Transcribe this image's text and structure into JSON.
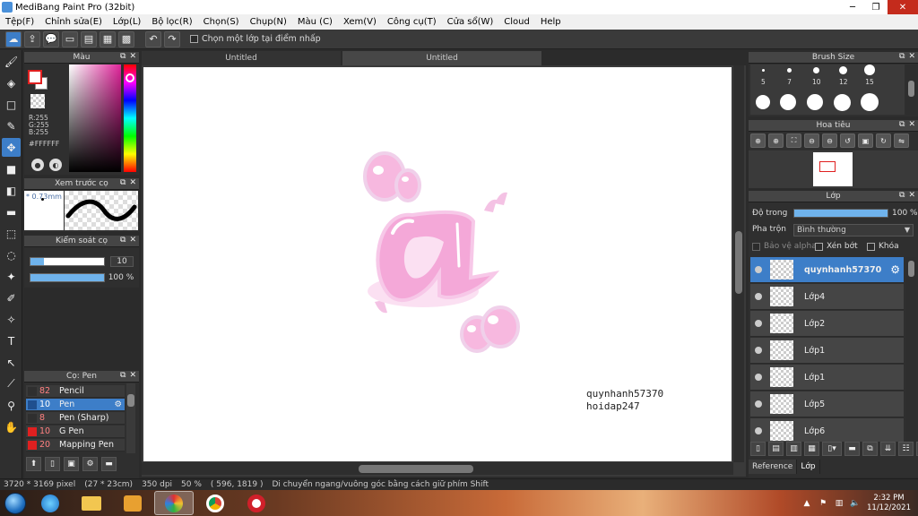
{
  "window": {
    "title": "MediBang Paint Pro (32bit)",
    "minimize": "─",
    "restore": "❐",
    "close": "✕"
  },
  "menu": [
    "Tệp(F)",
    "Chỉnh sửa(E)",
    "Lớp(L)",
    "Bộ lọc(R)",
    "Chọn(S)",
    "Chụp(N)",
    "Màu (C)",
    "Xem(V)",
    "Công cụ(T)",
    "Cửa sổ(W)",
    "Cloud",
    "Help"
  ],
  "toolbar": {
    "select_layer_label": "Chọn một lớp tại điểm nhấp"
  },
  "color_panel": {
    "title": "Màu",
    "r": "R:255",
    "g": "G:255",
    "b": "B:255",
    "hex": "#FFFFFF",
    "fg_color": "#ffffff"
  },
  "brush_preview": {
    "title": "Xem trước cọ",
    "size_text": "0.73mm"
  },
  "brush_control": {
    "title": "Kiểm soát cọ",
    "size_value": "10",
    "opacity_value": "100 %",
    "opacity_fraction": 1.0
  },
  "brush_list": {
    "title": "Cọ: Pen",
    "items": [
      {
        "size": "82",
        "name": "Pencil",
        "color": "#2f2f2f"
      },
      {
        "size": "10",
        "name": "Pen",
        "color": "#1f4f8f"
      },
      {
        "size": "8",
        "name": "Pen (Sharp)",
        "color": "#2f2f2f"
      },
      {
        "size": "10",
        "name": "G Pen",
        "color": "#e02020"
      },
      {
        "size": "20",
        "name": "Mapping Pen",
        "color": "#e02020"
      }
    ]
  },
  "tabs": [
    "Untitled",
    "Untitled"
  ],
  "canvas": {
    "watermark_line1": "quynhanh57370",
    "watermark_line2": "hoidap247"
  },
  "brush_size_panel": {
    "title": "Brush Size",
    "sizes": [
      "5",
      "7",
      "10",
      "12",
      "15"
    ]
  },
  "navigator": {
    "title": "Hoa tiêu"
  },
  "layer_panel": {
    "title": "Lớp",
    "opacity_label": "Độ trong",
    "opacity_value": "100 %",
    "blend_label": "Pha trộn",
    "blend_value": "Bình thường",
    "protect_alpha": "Bảo vệ alpha",
    "clipping": "Xén bớt",
    "lock": "Khóa",
    "layers": [
      "quynhanh57370",
      "Lớp4",
      "Lớp2",
      "Lớp1",
      "Lớp1",
      "Lớp5",
      "Lớp6"
    ]
  },
  "bottom_tabs": [
    "Reference",
    "Lớp"
  ],
  "status": {
    "dimensions": "3720 * 3169 pixel",
    "size_cm": "(27 * 23cm)",
    "dpi": "350 dpi",
    "zoom": "50 %",
    "coords": "( 596, 1819 )",
    "hint": "Di chuyển ngang/vuông góc bằng cách giữ phím Shift"
  },
  "taskbar": {
    "time": "2:32 PM",
    "date": "11/12/2021"
  },
  "colors": {
    "accent": "#3d7ec8",
    "art_pink": "#f4a8d8",
    "art_pink_dark": "#e98ad0"
  }
}
